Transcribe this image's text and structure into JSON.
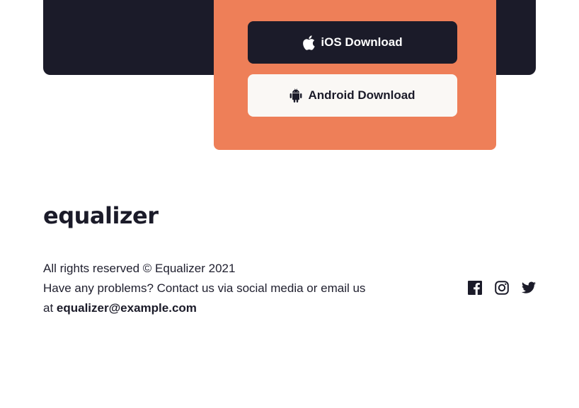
{
  "download": {
    "ios_label": "iOS Download",
    "android_label": "Android Download",
    "ios_icon": "apple-icon",
    "android_icon": "android-icon"
  },
  "brand": {
    "logo_text": "equalizer"
  },
  "footer": {
    "copyright": "All rights reserved © Equalizer 2021",
    "contact_prefix": "Have any problems? Contact us via social media or email us at ",
    "email": "equalizer@example.com",
    "social_icons": [
      "facebook-icon",
      "instagram-icon",
      "twitter-icon"
    ]
  },
  "colors": {
    "dark": "#1b1b29",
    "accent": "#ee7f58",
    "light_button": "#faf8f5"
  }
}
